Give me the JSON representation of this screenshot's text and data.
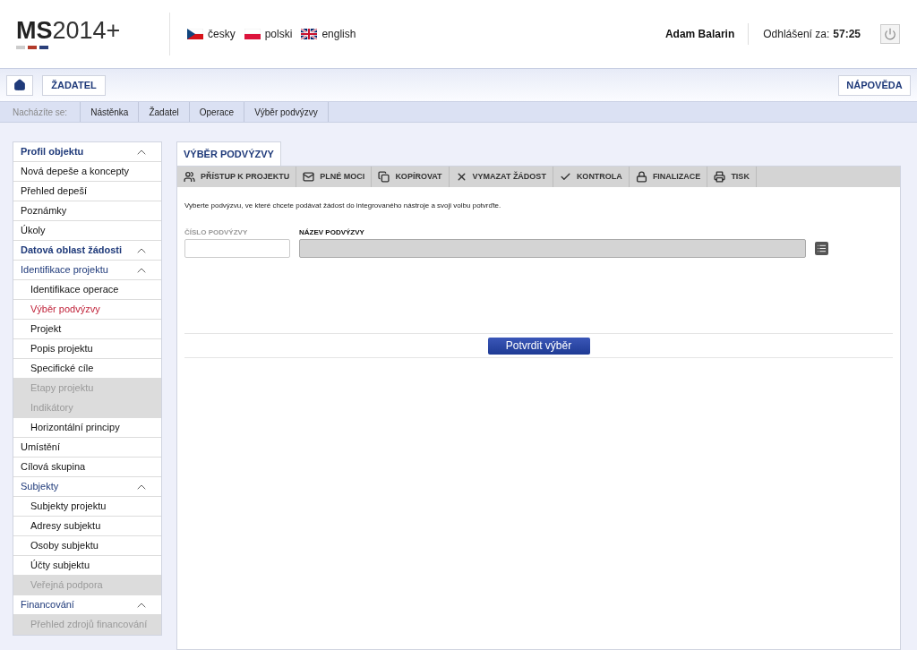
{
  "header": {
    "logo": {
      "bold": "MS",
      "rest": "2014+"
    },
    "languages": [
      {
        "label": "česky"
      },
      {
        "label": "polski"
      },
      {
        "label": "english"
      }
    ],
    "user": "Adam Balarin",
    "logout_label": "Odhlášení za:",
    "logout_time": "57:25"
  },
  "nav": {
    "role_button": "ŽADATEL",
    "help_button": "NÁPOVĚDA"
  },
  "breadcrumb": {
    "label": "Nacházíte se:",
    "items": [
      "Nástěnka",
      "Žadatel",
      "Operace",
      "Výběr podvýzvy"
    ]
  },
  "sidebar": [
    {
      "title": "Profil objektu",
      "expanded": true,
      "children": [
        {
          "label": "Nová depeše a koncepty",
          "selected": false,
          "disabled": false
        },
        {
          "label": "Přehled depeší",
          "selected": false,
          "disabled": false
        },
        {
          "label": "Poznámky",
          "selected": false,
          "disabled": false
        },
        {
          "label": "Úkoly",
          "selected": false,
          "disabled": false
        }
      ]
    },
    {
      "title": "Datová oblast žádosti",
      "expanded": true,
      "children": [
        {
          "label": "Identifikace projektu",
          "selected": false,
          "disabled": false,
          "expanded": true,
          "children": [
            {
              "label": "Identifikace operace",
              "selected": false,
              "disabled": false
            },
            {
              "label": "Výběr podvýzvy",
              "selected": true,
              "disabled": false
            },
            {
              "label": "Projekt",
              "selected": false,
              "disabled": false
            },
            {
              "label": "Popis projektu",
              "selected": false,
              "disabled": false
            },
            {
              "label": "Specifické cíle",
              "selected": false,
              "disabled": false
            },
            {
              "label": "Etapy projektu",
              "selected": false,
              "disabled": true
            },
            {
              "label": "Indikátory",
              "selected": false,
              "disabled": true
            },
            {
              "label": "Horizontální principy",
              "selected": false,
              "disabled": false
            }
          ]
        },
        {
          "label": "Umístění",
          "selected": false,
          "disabled": false
        },
        {
          "label": "Cílová skupina",
          "selected": false,
          "disabled": false
        },
        {
          "label": "Subjekty",
          "selected": false,
          "disabled": false,
          "expanded": true,
          "children": [
            {
              "label": "Subjekty projektu",
              "selected": false,
              "disabled": false
            },
            {
              "label": "Adresy subjektu",
              "selected": false,
              "disabled": false
            },
            {
              "label": "Osoby subjektu",
              "selected": false,
              "disabled": false
            },
            {
              "label": "Účty subjektu",
              "selected": false,
              "disabled": false
            },
            {
              "label": "Veřejná podpora",
              "selected": false,
              "disabled": true
            }
          ]
        },
        {
          "label": "Financování",
          "selected": false,
          "disabled": false,
          "expanded": true,
          "children": [
            {
              "label": "Přehled zdrojů financování",
              "selected": false,
              "disabled": true
            }
          ]
        }
      ]
    }
  ],
  "panel": {
    "tab": "VÝBĚR PODVÝZVY",
    "actions": [
      {
        "label": "PŘÍSTUP K PROJEKTU"
      },
      {
        "label": "PLNÉ MOCI"
      },
      {
        "label": "KOPÍROVAT"
      },
      {
        "label": "VYMAZAT ŽÁDOST"
      },
      {
        "label": "KONTROLA"
      },
      {
        "label": "FINALIZACE"
      },
      {
        "label": "TISK"
      }
    ],
    "instruction": "Vyberte podvýzvu, ve které chcete podávat žádost do integrovaného nástroje a svoji volbu potvrďte.",
    "fields": [
      {
        "label": "ČÍSLO PODVÝZVY",
        "disabled": false
      },
      {
        "label": "NÁZEV PODVÝZVY",
        "disabled": true
      }
    ],
    "confirm_button": "Potvrdit výběr"
  }
}
